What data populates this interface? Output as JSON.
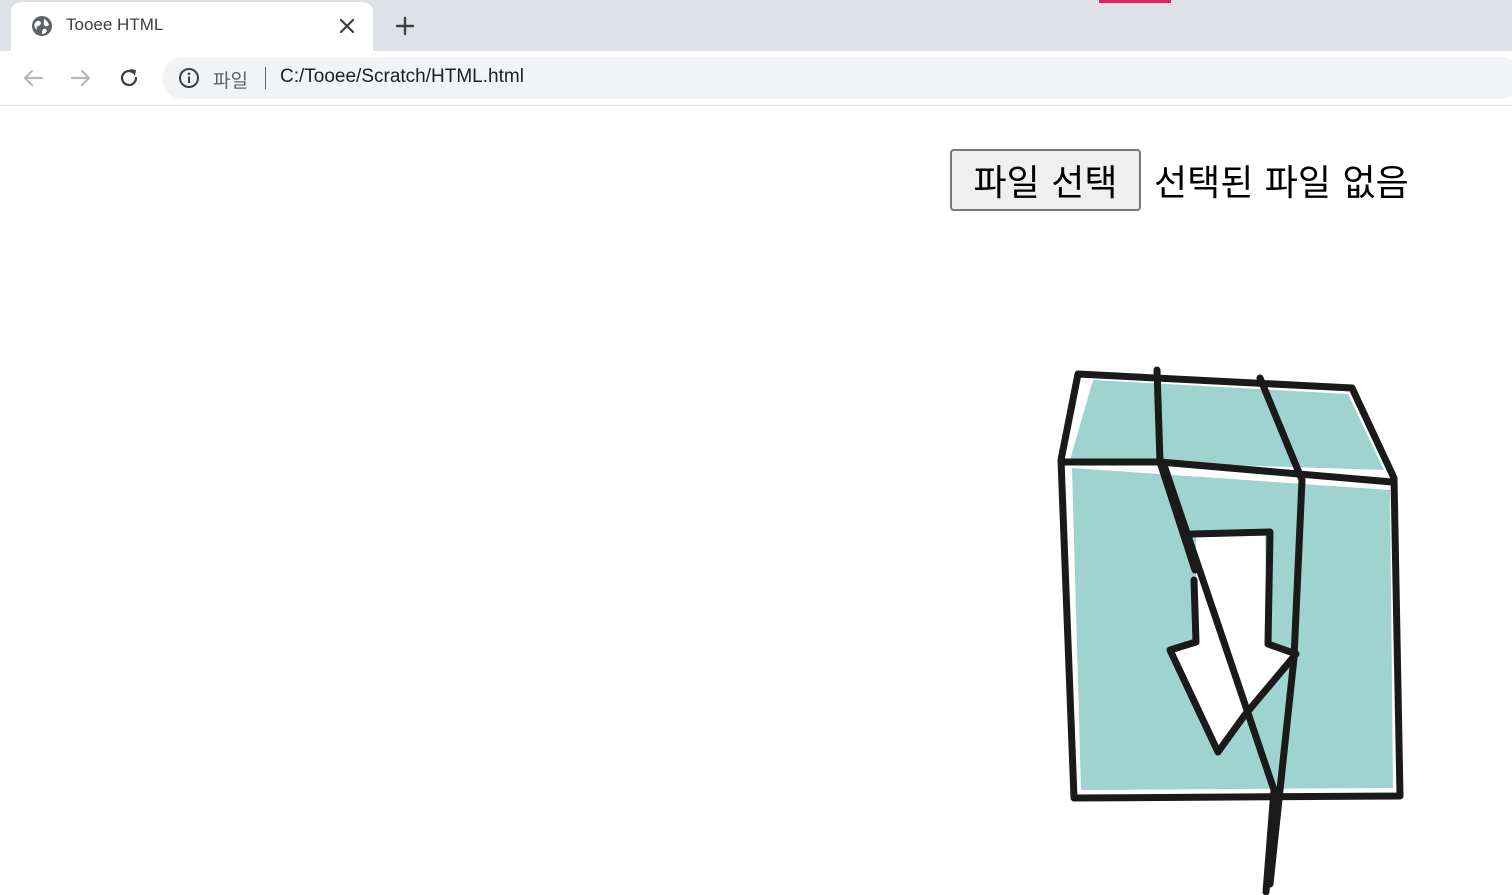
{
  "browser": {
    "tab": {
      "title": "Tooee HTML",
      "favicon": "globe-icon",
      "close_icon": "close-icon"
    },
    "new_tab_icon": "plus-icon",
    "accent_color": "#e0245e",
    "toolbar": {
      "back_icon": "arrow-left-icon",
      "forward_icon": "arrow-right-icon",
      "reload_icon": "reload-icon",
      "site_info_icon": "info-icon",
      "scheme_label": "파일",
      "url": "C:/Tooee/Scratch/HTML.html"
    }
  },
  "page": {
    "file_input": {
      "button_label": "파일 선택",
      "status_text": "선택된 파일 없음"
    },
    "illustration": {
      "icon": "box-download-icon",
      "fill_color": "#9fd3d0",
      "stroke_color": "#1a1a1a"
    }
  }
}
